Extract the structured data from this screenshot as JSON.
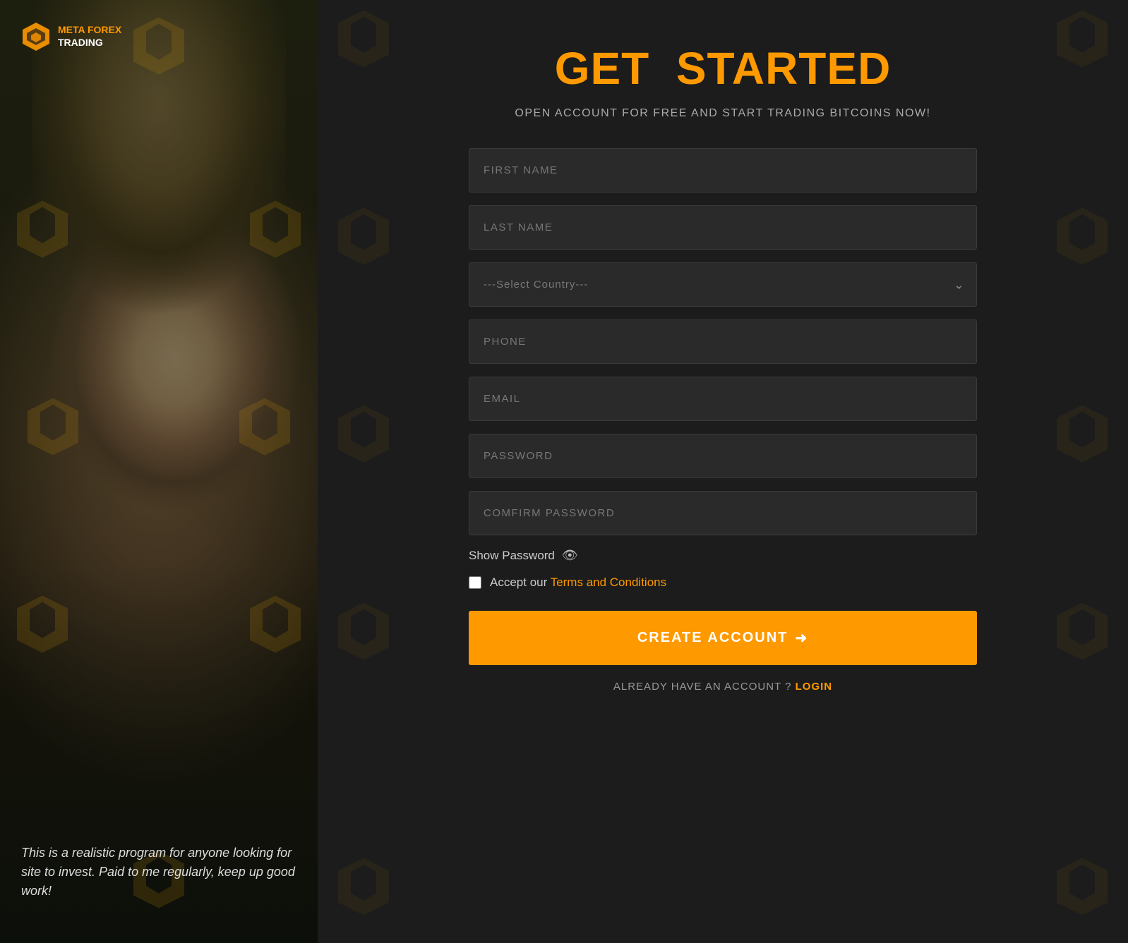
{
  "brand": {
    "name_line1": "META FOREX",
    "name_line2": "TRADING",
    "icon_alt": "meta-forex-logo"
  },
  "left": {
    "testimonial": "This is a realistic program for anyone looking for site to invest. Paid to me regularly, keep up good work!"
  },
  "page": {
    "title_white": "GET",
    "title_orange": "STARTED",
    "subtitle": "OPEN ACCOUNT FOR FREE AND START TRADING BITCOINS NOW!",
    "form": {
      "first_name_placeholder": "FIRST NAME",
      "last_name_placeholder": "LAST NAME",
      "country_default": "---Select Country---",
      "phone_placeholder": "PHONE",
      "email_placeholder": "EMAIL",
      "password_placeholder": "PASSWORD",
      "confirm_password_placeholder": "COMFIRM PASSWORD",
      "show_password_label": "Show Password",
      "terms_label": "Accept our ",
      "terms_link_label": "Terms and Conditions",
      "create_account_label": "CREATE ACCOUNT",
      "already_label": "ALREADY HAVE AN ACCOUNT ?",
      "login_label": "LOGIN"
    }
  }
}
